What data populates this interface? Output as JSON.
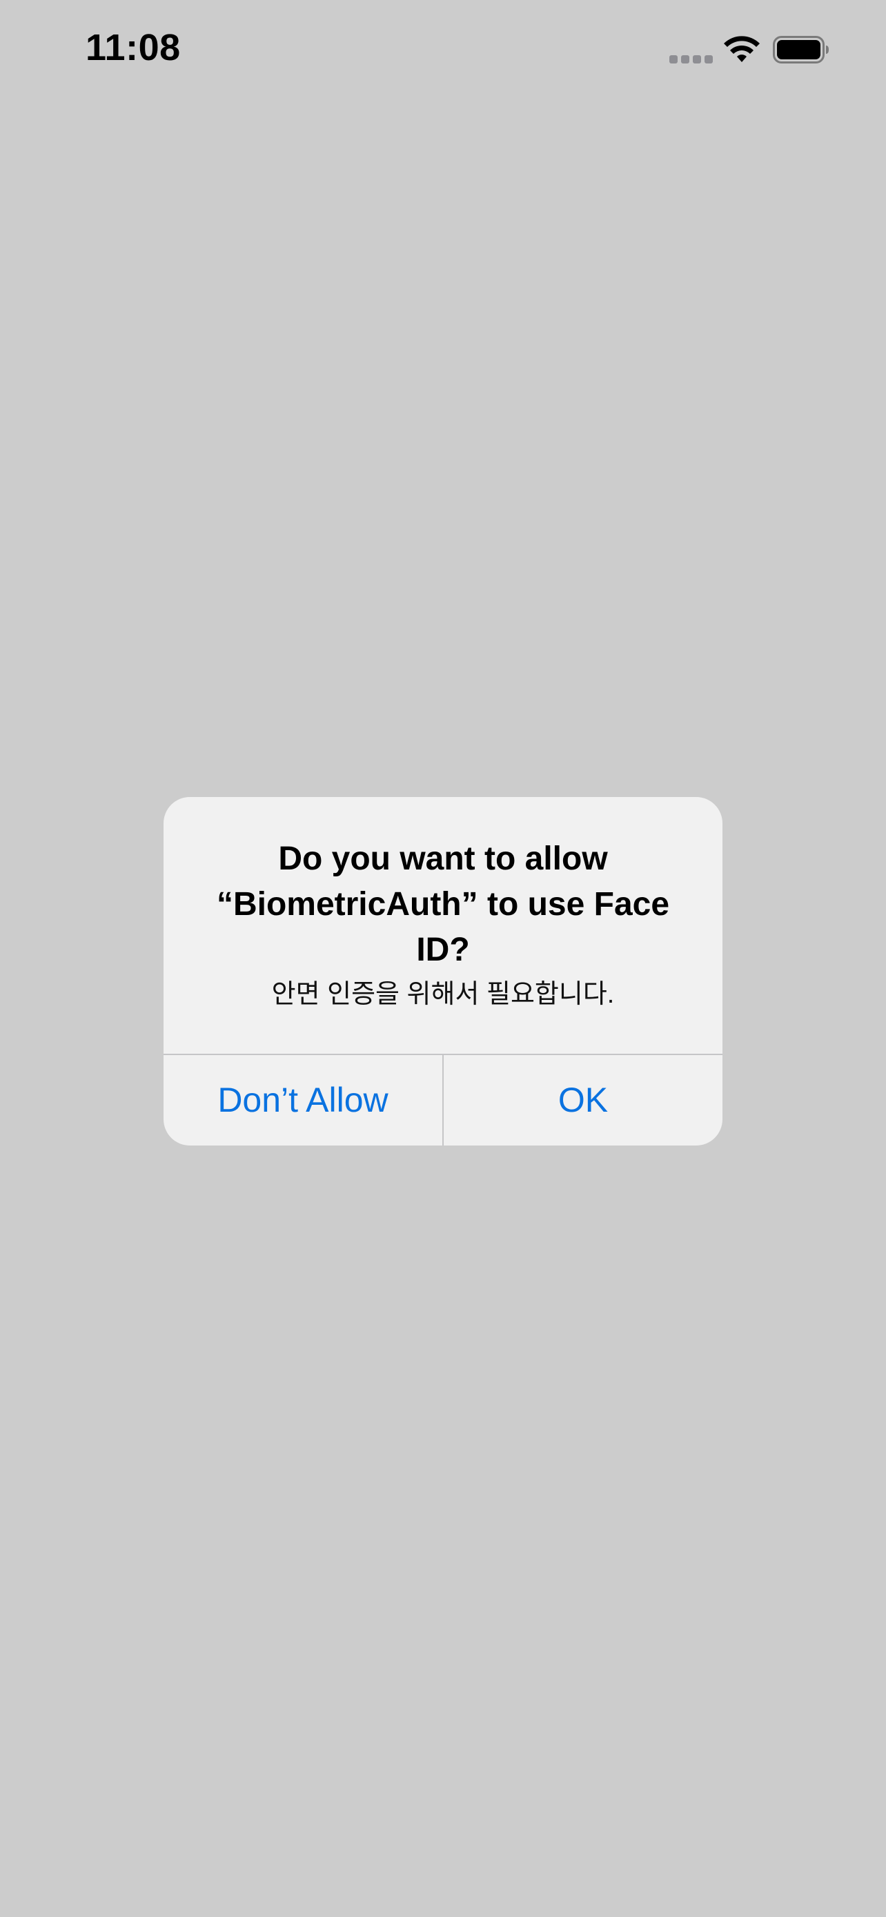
{
  "status_bar": {
    "time": "11:08",
    "icons": [
      "cellular-signal-icon",
      "wifi-icon",
      "battery-icon"
    ]
  },
  "alert": {
    "title": "Do you want to allow “BiometricAuth” to use Face ID?",
    "message": "안면 인증을 위해서 필요합니다.",
    "buttons": {
      "deny_label": "Don’t Allow",
      "allow_label": "OK"
    }
  },
  "colors": {
    "background": "#cccccc",
    "alert_background": "#f1f1f1",
    "button_text": "#0a72e0",
    "divider": "#c5c5c7"
  }
}
